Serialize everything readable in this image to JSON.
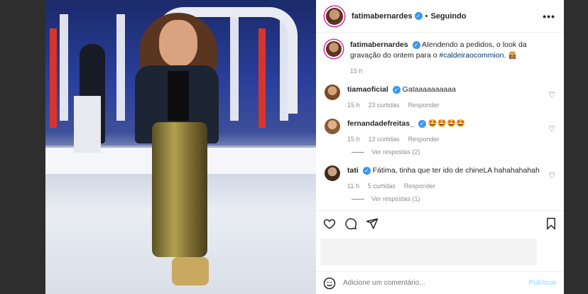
{
  "post": {
    "author": "fatimabernardes",
    "follow_status": "Seguindo",
    "caption_user": "fatimabernardes",
    "caption_text": "Atendendo a pedidos, o look da gravação do ontem para o ",
    "caption_hashtag": "#caldeiraocommion",
    "caption_emoji": ". 👸🏽",
    "caption_time": "15 h"
  },
  "comments": [
    {
      "user": "tiamaoficial",
      "verified": true,
      "text": "Gataaaaaaaaaa",
      "time": "15 h",
      "likes": "23 curtidas",
      "reply": "Responder",
      "view_replies": ""
    },
    {
      "user": "fernandadefreitas_",
      "verified": true,
      "text": "🤩🤩🤩🤩",
      "time": "15 h",
      "likes": "13 curtidas",
      "reply": "Responder",
      "view_replies": "Ver respostas (2)"
    },
    {
      "user": "tati",
      "verified": true,
      "text": "Fátima, tinha que ter ido de chineLA hahahahahah",
      "time": "11 h",
      "likes": "5 curtidas",
      "reply": "Responder",
      "view_replies": "Ver respostas (1)"
    }
  ],
  "composer": {
    "placeholder": "Adicione um comentário...",
    "publish_label": "Publicar"
  },
  "colors": {
    "link": "#00376b",
    "verified": "#3897f0",
    "publish_disabled": "#b2dffc"
  }
}
